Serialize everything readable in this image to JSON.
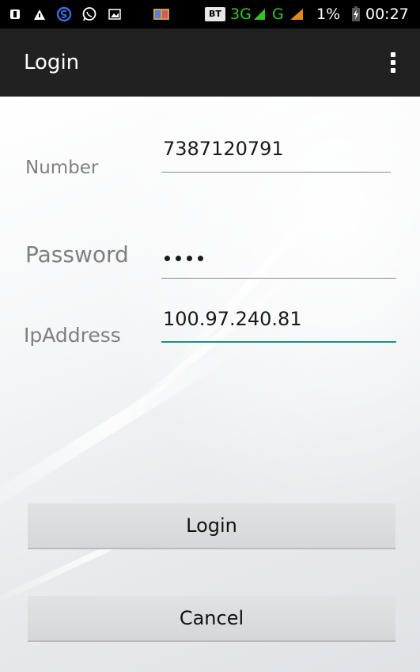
{
  "status_bar": {
    "icons_left": [
      "notification-icon",
      "bluetooth-file-icon",
      "s-app-icon",
      "whatsapp-icon",
      "image-icon",
      "gallery-icon"
    ],
    "bt_badge": "BT",
    "network_3g": "3G",
    "network_g": "G",
    "battery_percent": "1%",
    "time": "00:27"
  },
  "action_bar": {
    "title": "Login",
    "overflow_icon": "overflow-menu-icon"
  },
  "form": {
    "number": {
      "label": "Number",
      "value": "7387120791"
    },
    "password": {
      "label": "Password",
      "masked_length": 4
    },
    "ip_address": {
      "label": "IpAddress",
      "value": "100.97.240.81"
    }
  },
  "buttons": {
    "login": "Login",
    "cancel": "Cancel"
  },
  "colors": {
    "status_bar": "#000000",
    "action_bar": "#212121",
    "focus_accent": "#1a9482",
    "network_green": "#37c22a"
  }
}
